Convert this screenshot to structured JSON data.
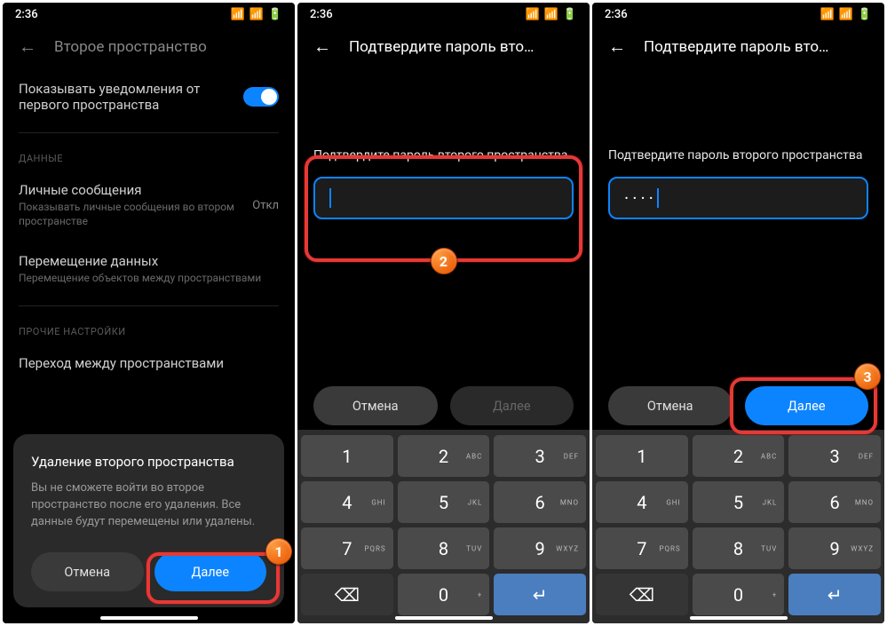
{
  "statusbar": {
    "time": "2:36"
  },
  "p1": {
    "header_title": "Второе пространство",
    "notif_label": "Показывать уведомления от первого пространства",
    "section_data": "ДАННЫЕ",
    "msgs_title": "Личные сообщения",
    "msgs_sub": "Показывать личные сообщения во втором пространстве",
    "msgs_status": "Откл",
    "move_title": "Перемещение данных",
    "move_sub": "Перемещение объектов между пространствами",
    "section_other": "ПРОЧИЕ НАСТРОЙКИ",
    "switch_title": "Переход между пространствами",
    "dialog": {
      "title": "Удаление второго пространства",
      "body": "Вы не сможете войти во второе пространство после его удаления. Все данные будут перемещены или удалены.",
      "cancel": "Отмена",
      "next": "Далее"
    }
  },
  "p2": {
    "header_title": "Подтвердите пароль вто…",
    "label": "Подтвердите пароль второго пространства",
    "value": "",
    "cancel": "Отмена",
    "next": "Далее"
  },
  "p3": {
    "header_title": "Подтвердите пароль вто…",
    "label": "Подтвердите пароль второго пространства",
    "value": "····",
    "cancel": "Отмена",
    "next": "Далее"
  },
  "keypad": {
    "k1": "1",
    "k2": "2",
    "k3": "3",
    "k4": "4",
    "k5": "5",
    "k6": "6",
    "k7": "7",
    "k8": "8",
    "k9": "9",
    "k0": "0",
    "l2": "ABC",
    "l3": "DEF",
    "l4": "GHI",
    "l5": "JKL",
    "l6": "MNO",
    "l7": "PQRS",
    "l8": "TUV",
    "l9": "WXYZ",
    "l0": "+"
  },
  "badges": {
    "b1": "1",
    "b2": "2",
    "b3": "3"
  }
}
